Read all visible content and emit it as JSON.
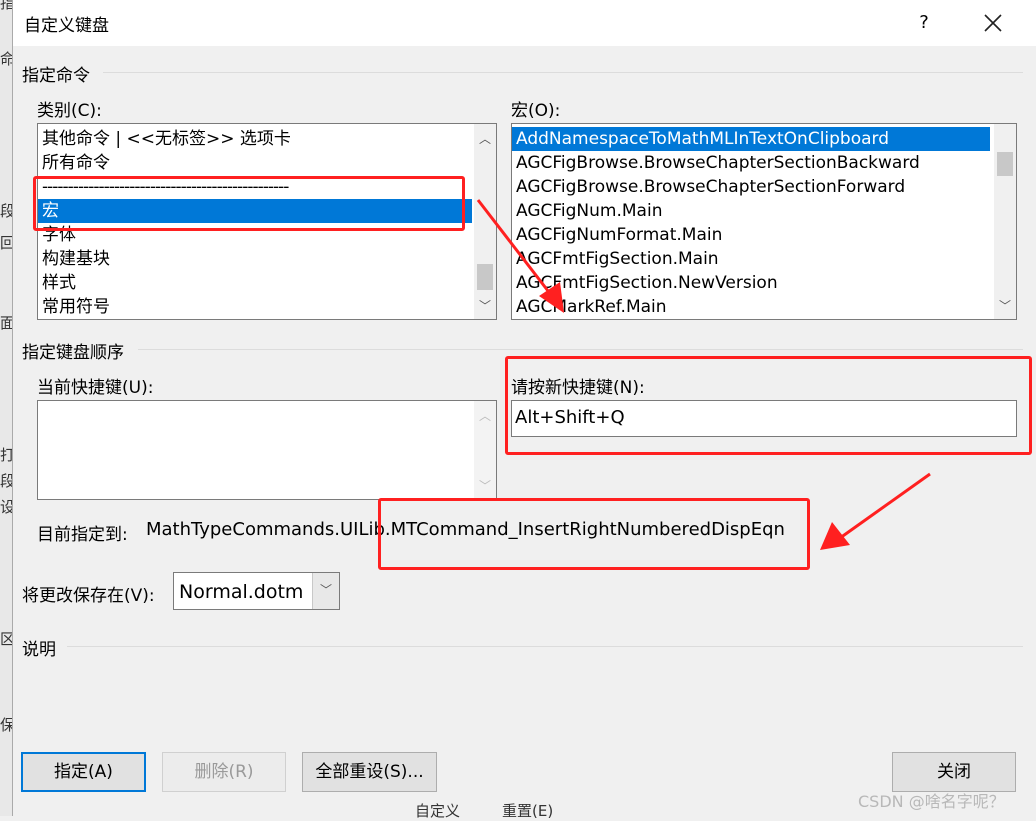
{
  "window": {
    "title": "自定义键盘",
    "help": "?",
    "close": "✕"
  },
  "groups": {
    "commands": "指定命令",
    "keyboard": "指定键盘顺序",
    "description": "说明"
  },
  "categories": {
    "label": "类别(C):",
    "items": [
      "其他命令 | <<无标签>> 选项卡",
      "所有命令",
      "------------------------------------------------",
      "宏",
      "字体",
      "构建基块",
      "样式",
      "常用符号"
    ],
    "selected": "宏"
  },
  "macros": {
    "label": "宏(O):",
    "items": [
      "AddNamespaceToMathMLInTextOnClipboard",
      "AGCFigBrowse.BrowseChapterSectionBackward",
      "AGCFigBrowse.BrowseChapterSectionForward",
      "AGCFigNum.Main",
      "AGCFigNumFormat.Main",
      "AGCFmtFigSection.Main",
      "AGCFmtFigSection.NewVersion",
      "AGCMarkRef.Main"
    ],
    "selected": "AddNamespaceToMathMLInTextOnClipboard"
  },
  "current_keys": {
    "label": "当前快捷键(U):"
  },
  "new_key": {
    "label": "请按新快捷键(N):",
    "value": "Alt+Shift+Q"
  },
  "assigned": {
    "label": "目前指定到:",
    "value": "MathTypeCommands.UILib.MTCommand_InsertRightNumberedDispEqn"
  },
  "save_in": {
    "label": "将更改保存在(V):",
    "value": "Normal.dotm"
  },
  "buttons": {
    "assign": "指定(A)",
    "remove": "删除(R)",
    "reset_all": "全部重设(S)...",
    "close": "关闭"
  },
  "watermark": "CSDN @啥名字呢？",
  "background_fragments": [
    "指",
    "命",
    "段",
    "回",
    "面",
    "打",
    "段",
    "设",
    "区",
    "保",
    "自定义",
    "重置(E)"
  ],
  "annotations": {
    "color": "#ff2020"
  }
}
